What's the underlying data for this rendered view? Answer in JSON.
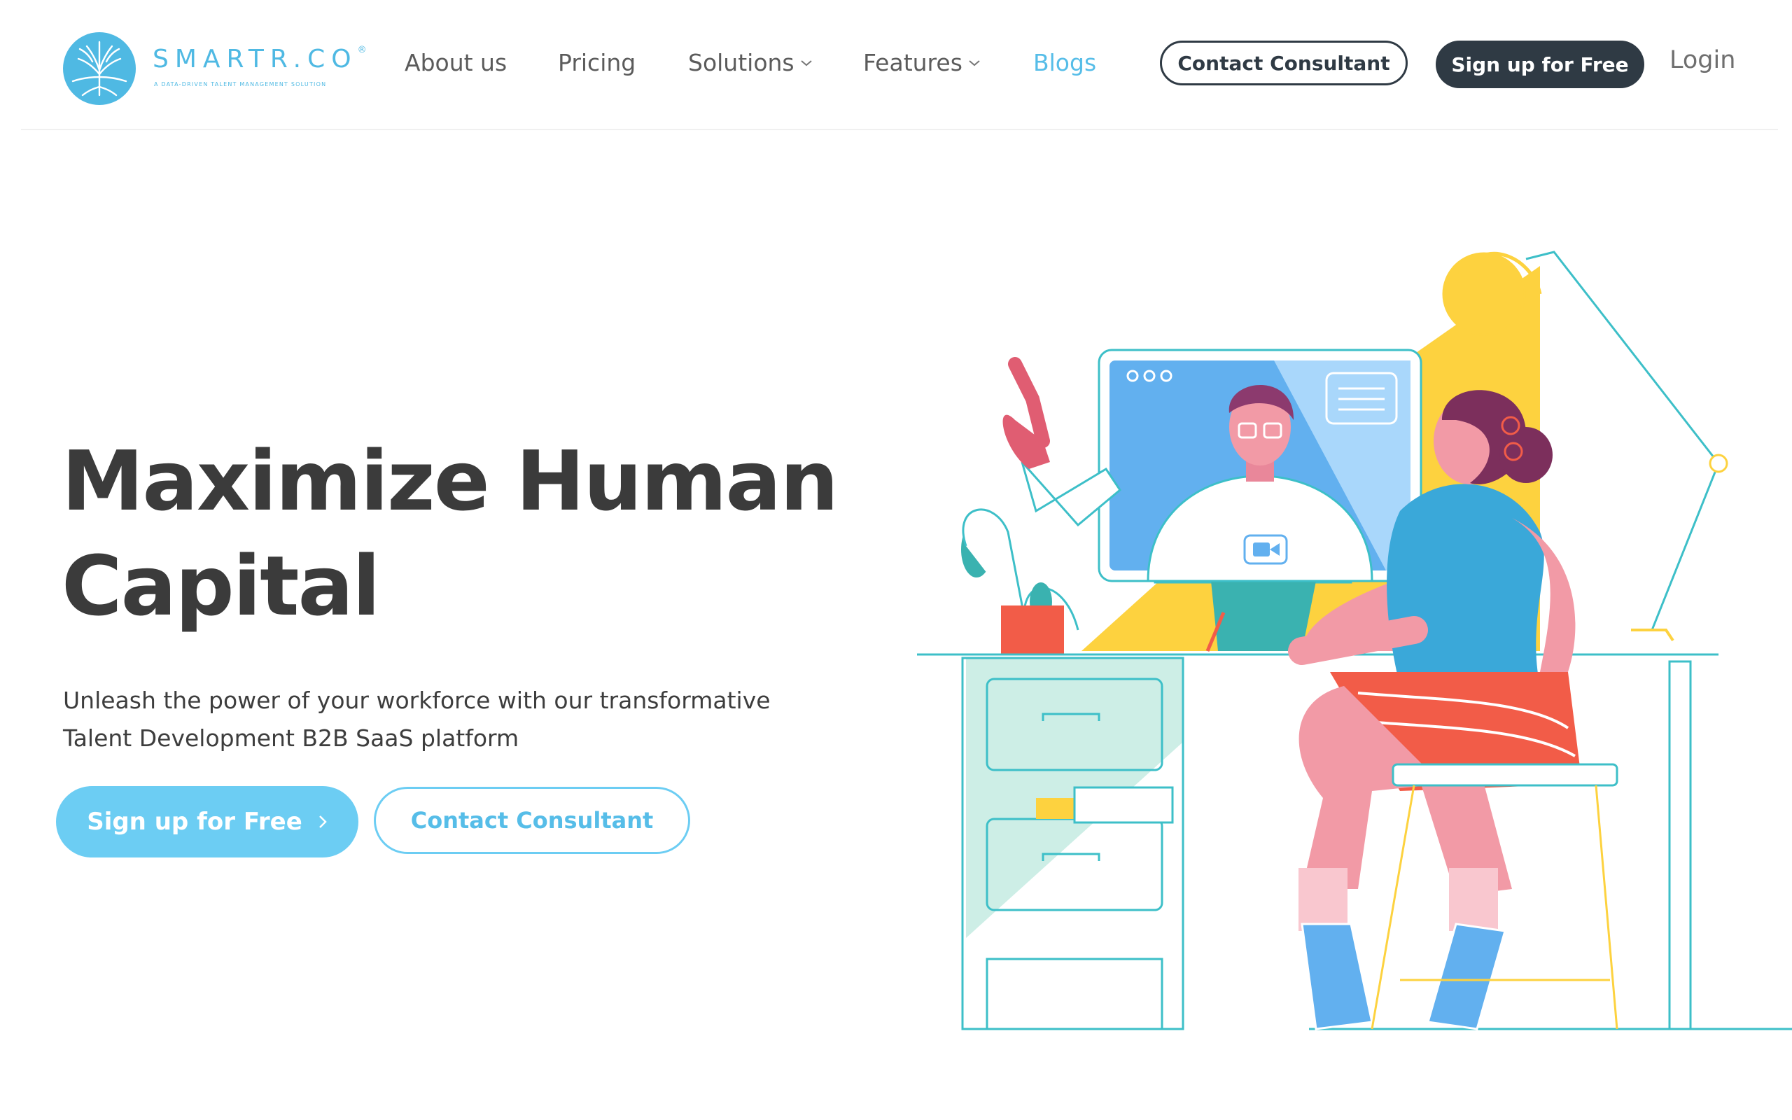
{
  "brand": {
    "name": "SMARTR.CO",
    "registered": "®",
    "tagline": "A DATA-DRIVEN TALENT MANAGEMENT SOLUTION",
    "color": "#4fb9e3"
  },
  "nav": {
    "items": [
      {
        "label": "About us"
      },
      {
        "label": "Pricing"
      },
      {
        "label": "Solutions",
        "has_dropdown": true
      },
      {
        "label": "Features",
        "has_dropdown": true
      },
      {
        "label": "Blogs",
        "active": true
      }
    ],
    "contact_label": "Contact Consultant",
    "signup_label": "Sign up for Free",
    "login_label": "Login"
  },
  "hero": {
    "title_line1": "Maximize Human",
    "title_line2": "Capital",
    "subtitle_line1": "Unleash the power of your workforce with our transformative",
    "subtitle_line2": "Talent Development B2B SaaS platform",
    "primary_cta": "Sign up for Free",
    "primary_cta_icon": "chevron-right-icon",
    "secondary_cta": "Contact Consultant"
  },
  "colors": {
    "accent": "#6ccdf3",
    "accent_text": "#56bde8",
    "dark": "#2f3a44",
    "heading": "#3b3b3b"
  }
}
